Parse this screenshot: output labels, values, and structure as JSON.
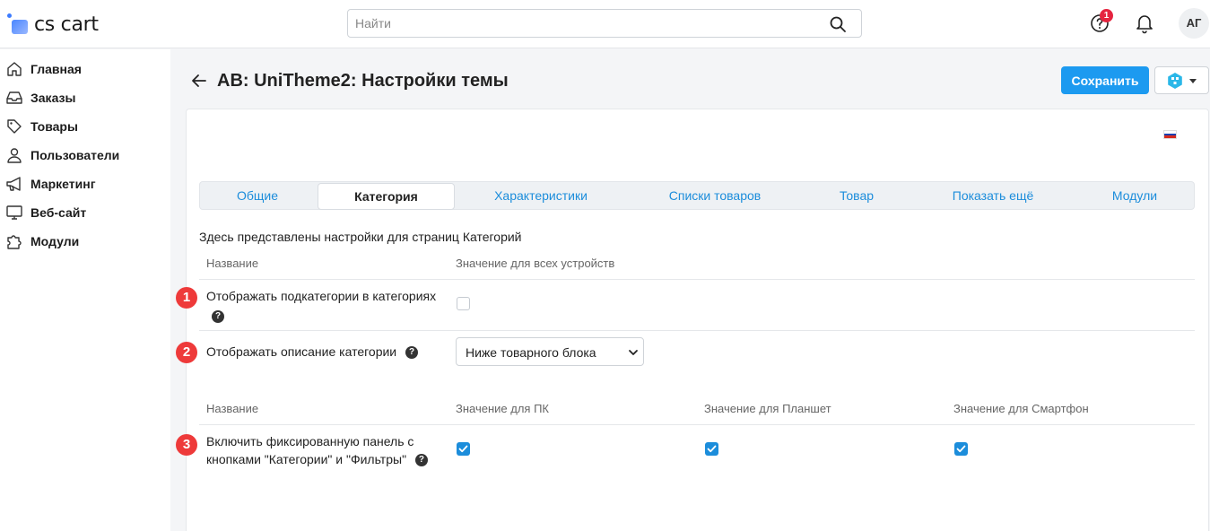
{
  "header": {
    "logo_text": "cs cart",
    "search_placeholder": "Найти",
    "notification_count": "1",
    "avatar_initials": "АГ"
  },
  "sidebar": {
    "items": [
      {
        "label": "Главная",
        "icon": "home-icon"
      },
      {
        "label": "Заказы",
        "icon": "inbox-icon"
      },
      {
        "label": "Товары",
        "icon": "tag-icon"
      },
      {
        "label": "Пользователи",
        "icon": "user-icon"
      },
      {
        "label": "Маркетинг",
        "icon": "megaphone-icon"
      },
      {
        "label": "Веб-сайт",
        "icon": "monitor-icon"
      },
      {
        "label": "Модули",
        "icon": "puzzle-icon"
      }
    ]
  },
  "page": {
    "title": "AB: UniTheme2: Настройки темы",
    "save_label": "Сохранить"
  },
  "tabs": [
    {
      "label": "Общие",
      "active": false
    },
    {
      "label": "Категория",
      "active": true
    },
    {
      "label": "Характеристики",
      "active": false
    },
    {
      "label": "Списки товаров",
      "active": false
    },
    {
      "label": "Товар",
      "active": false
    },
    {
      "label": "Показать ещё",
      "active": false
    },
    {
      "label": "Модули",
      "active": false
    }
  ],
  "content": {
    "description": "Здесь представлены настройки для страниц Категорий",
    "section1": {
      "col_name": "Название",
      "col_value": "Значение для всех устройств",
      "settings": [
        {
          "number": "1",
          "label": "Отображать подкатегории в категориях",
          "help": "?",
          "checked": false
        },
        {
          "number": "2",
          "label": "Отображать описание категории",
          "help": "?",
          "select_value": "Ниже товарного блока"
        }
      ]
    },
    "section2": {
      "col_name": "Название",
      "col_pc": "Значение для ПК",
      "col_tablet": "Значение для Планшет",
      "col_phone": "Значение для Смартфон",
      "settings": [
        {
          "number": "3",
          "label_line1": "Включить фиксированную панель с",
          "label_line2": "кнопками \"Категории\" и \"Фильтры\"",
          "help": "?",
          "pc": true,
          "tablet": true,
          "phone": true
        }
      ]
    }
  },
  "colors": {
    "accent": "#1c9af0",
    "link": "#1c8ddb",
    "marker": "#ee3a3a",
    "badge": "#e5243f"
  }
}
